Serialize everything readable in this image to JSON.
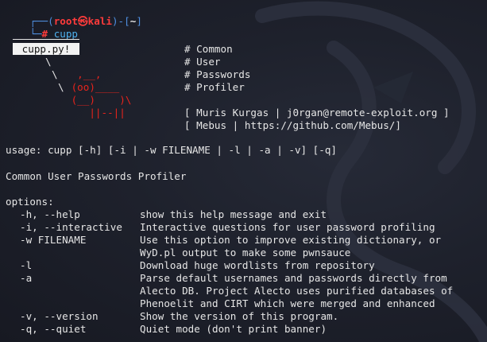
{
  "prompt": {
    "user": "root",
    "skull": "㉿",
    "host": "kali",
    "cwd": "~",
    "command": "cupp"
  },
  "banner": {
    "box_label": "cupp.py!",
    "slash1": "\\",
    "slash2": "\\",
    "slash3": "\\",
    "ascii": [
      "  ,__,",
      " (oo)____",
      " (__)    )\\",
      "    ||--|| "
    ],
    "lines": [
      "# Common",
      "# User",
      "# Passwords",
      "# Profiler"
    ],
    "credits": [
      "[ Muris Kurgas | j0rgan@remote-exploit.org ]",
      "[ Mebus | https://github.com/Mebus/]"
    ]
  },
  "usage": "usage: cupp [-h] [-i | -w FILENAME | -l | -a | -v] [-q]",
  "description": "Common User Passwords Profiler",
  "options_header": "options:",
  "options": [
    {
      "name": "-h, --help",
      "desc": [
        "show this help message and exit"
      ]
    },
    {
      "name": "-i, --interactive",
      "desc": [
        "Interactive questions for user password profiling"
      ]
    },
    {
      "name": "-w FILENAME",
      "desc": [
        "Use this option to improve existing dictionary, or",
        "WyD.pl output to make some pwnsauce"
      ]
    },
    {
      "name": "-l",
      "desc": [
        "Download huge wordlists from repository"
      ]
    },
    {
      "name": "-a",
      "desc": [
        "Parse default usernames and passwords directly from",
        "Alecto DB. Project Alecto uses purified databases of",
        "Phenoelit and CIRT which were merged and enhanced"
      ]
    },
    {
      "name": "-v, --version",
      "desc": [
        "Show the version of this program."
      ]
    },
    {
      "name": "-q, --quiet",
      "desc": [
        "Quiet mode (don't print banner)"
      ]
    }
  ],
  "colors": {
    "background": "#1e212c",
    "prompt_frame": "#4f8fe0",
    "user_host": "#ff3b3b",
    "command": "#4fb2f0",
    "ascii_cow": "#e8241c",
    "text": "#e6e6e6"
  }
}
